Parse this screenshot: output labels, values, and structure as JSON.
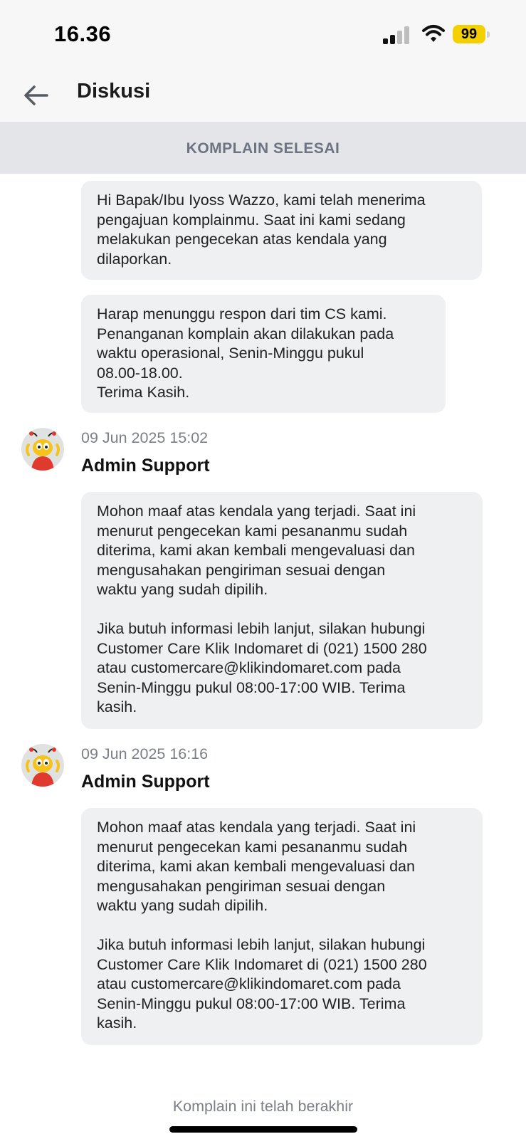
{
  "status_bar": {
    "time": "16.36",
    "battery_level": "99",
    "battery_color": "#f5d000"
  },
  "header": {
    "title": "Diskusi",
    "back_icon": "arrow-left-icon"
  },
  "banner": {
    "text": "KOMPLAIN SELESAI"
  },
  "messages": [
    {
      "lines": [
        "Hi Bapak/Ibu Iyoss Wazzo, kami telah menerima",
        "pengajuan komplainmu. Saat ini kami sedang",
        "melakukan pengecekan atas kendala yang",
        "dilaporkan."
      ]
    },
    {
      "lines": [
        "Harap menunggu respon dari tim CS kami.",
        "Penanganan komplain akan dilakukan pada",
        "waktu operasional, Senin-Minggu pukul",
        "08.00-18.00.",
        "Terima Kasih."
      ]
    },
    {
      "timestamp": "09 Jun 2025 15:02",
      "sender": "Admin Support",
      "lines": [
        "Mohon maaf atas kendala yang terjadi. Saat ini",
        "menurut pengecekan kami pesananmu sudah",
        "diterima, kami akan kembali mengevaluasi dan",
        "mengusahakan pengiriman sesuai dengan",
        "waktu yang sudah dipilih.",
        "",
        "Jika butuh informasi lebih lanjut, silakan hubungi",
        "Customer Care Klik Indomaret di (021) 1500 280",
        "atau customercare@klikindomaret.com pada",
        "Senin-Minggu pukul 08:00-17:00 WIB. Terima",
        "kasih."
      ]
    },
    {
      "timestamp": "09 Jun 2025 16:16",
      "sender": "Admin Support",
      "lines": [
        "Mohon maaf atas kendala yang terjadi. Saat ini",
        "menurut pengecekan kami pesananmu sudah",
        "diterima, kami akan kembali mengevaluasi dan",
        "mengusahakan pengiriman sesuai dengan",
        "waktu yang sudah dipilih.",
        "",
        "Jika butuh informasi lebih lanjut, silakan hubungi",
        "Customer Care Klik Indomaret di (021) 1500 280",
        "atau customercare@klikindomaret.com pada",
        "Senin-Minggu pukul 08:00-17:00 WIB. Terima",
        "kasih."
      ]
    }
  ],
  "footer": {
    "text": "Komplain ini telah berakhir"
  }
}
